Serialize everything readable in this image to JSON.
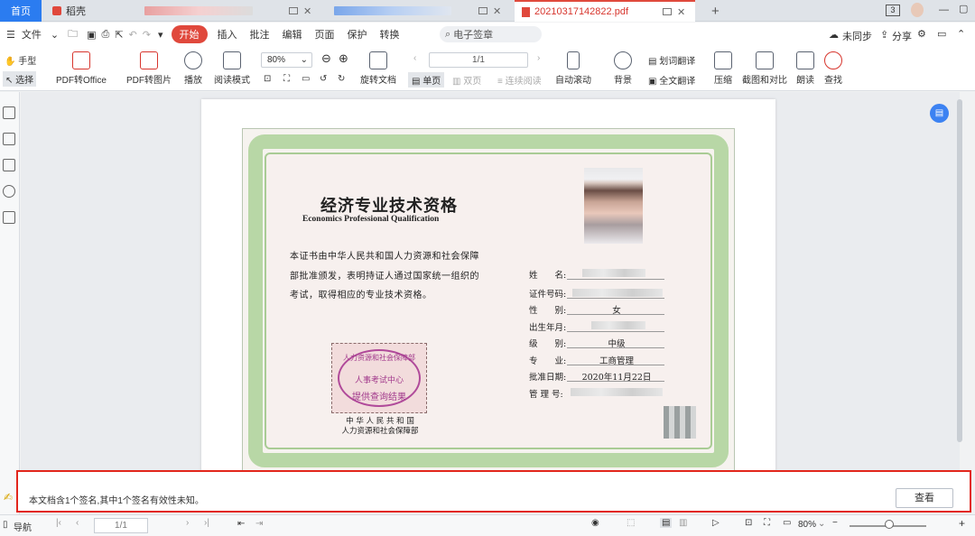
{
  "tabs": {
    "home": "首页",
    "daoke": "稻壳",
    "pdf": "20210317142822.pdf",
    "new_tab": "+",
    "badge": "3"
  },
  "menu": {
    "file": "文件",
    "start": "开始",
    "insert": "插入",
    "annotate": "批注",
    "edit": "编辑",
    "page": "页面",
    "protect": "保护",
    "convert": "转换",
    "search": "电子签章",
    "unsync": "未同步",
    "share": "分享"
  },
  "tools": {
    "hand": "手型",
    "select": "选择",
    "pdf_office": "PDF转Office",
    "pdf_image": "PDF转图片",
    "play": "播放",
    "read_mode": "阅读模式",
    "zoom": "80%",
    "rotate": "旋转文档",
    "page_input": "1/1",
    "single": "单页",
    "double": "双页",
    "continuous": "连续阅读",
    "autoscroll": "自动滚动",
    "background": "背景",
    "translate": "划词翻译",
    "fulltrans": "全文翻译",
    "compress": "压缩",
    "screenshot": "截图和对比",
    "read": "朗读",
    "find": "查找"
  },
  "certificate": {
    "title": "经济专业技术资格",
    "subtitle": "Economics Professional Qualification",
    "body": "本证书由中华人民共和国人力资源和社会保障部批准颁发，表明持证人通过国家统一组织的考试，取得相应的专业技术资格。",
    "stamp": {
      "line1": "人力资源和社会保障部",
      "line2": "人事考试中心",
      "line3": "提供查询结果"
    },
    "issuer1": "中 华 人 民 共 和 国",
    "issuer2": "人力资源和社会保障部",
    "fields": {
      "name": "姓　　名:",
      "cert_no": "证件号码:",
      "gender": "性　　别:",
      "birth": "出生年月:",
      "level": "级　　别:",
      "major": "专　　业:",
      "date": "批准日期:",
      "mgmt": "管 理 号:"
    },
    "values": {
      "gender": "女",
      "level": "中级",
      "major": "工商管理",
      "date": "2020年11月22日"
    }
  },
  "signature": {
    "message": "本文档含1个签名,其中1个签名有效性未知。",
    "view": "查看"
  },
  "status": {
    "nav": "导航",
    "page": "1/1",
    "zoom": "80%"
  }
}
